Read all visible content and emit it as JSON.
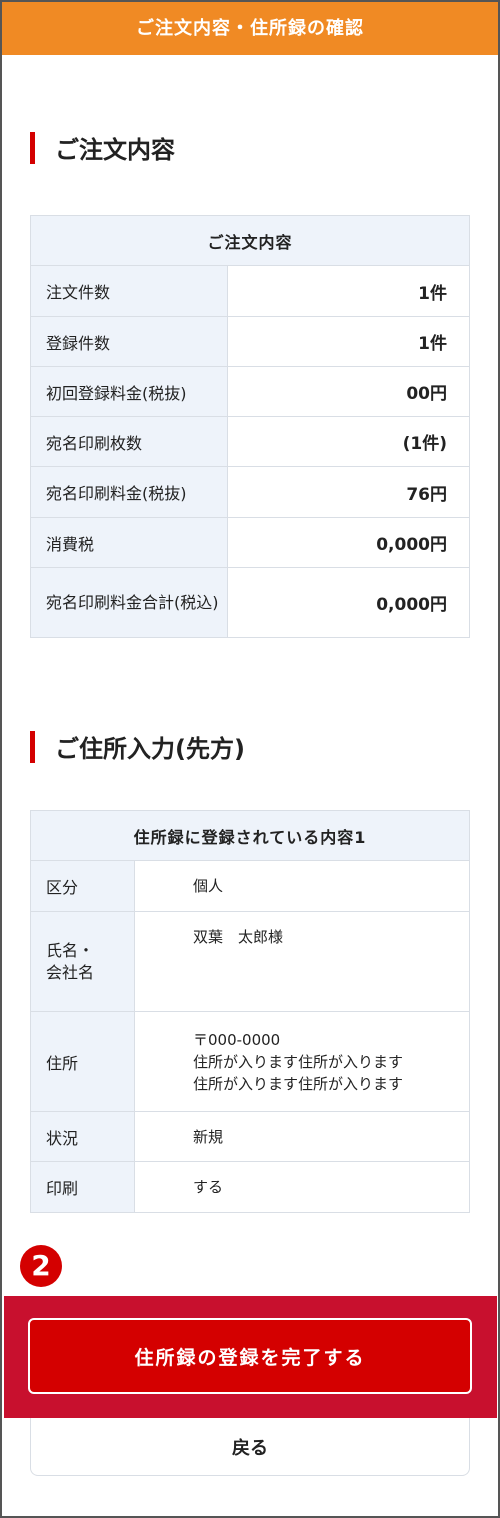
{
  "header": {
    "title": "ご注文内容・住所録の確認"
  },
  "order_section": {
    "title": "ご注文内容",
    "table_header": "ご注文内容",
    "rows": [
      {
        "label": "注文件数",
        "value": "1件"
      },
      {
        "label": "登録件数",
        "value": "1件"
      },
      {
        "label": "初回登録料金(税抜)",
        "value": "00円"
      },
      {
        "label": "宛名印刷枚数",
        "value": "(1件)"
      },
      {
        "label": "宛名印刷料金(税抜)",
        "value": "76円"
      },
      {
        "label": "消費税",
        "value": "0,000円"
      },
      {
        "label": "宛名印刷料金合計(税込)",
        "value": "0,000円"
      }
    ]
  },
  "address_section": {
    "title": "ご住所入力(先方)",
    "table_header": "住所録に登録されている内容1",
    "rows": [
      {
        "label": "区分",
        "value": "個人"
      },
      {
        "label": "氏名・\n会社名",
        "value": "双葉　太郎様"
      },
      {
        "label": "住所",
        "value": "〒000-0000\n住所が入ります住所が入ります\n住所が入ります住所が入ります"
      },
      {
        "label": "状況",
        "value": "新規"
      },
      {
        "label": "印刷",
        "value": "する"
      }
    ]
  },
  "step_badge": "2",
  "buttons": {
    "complete": "住所録の登録を完了する",
    "back": "戻る"
  },
  "colors": {
    "header_bg": "#f08a24",
    "accent_red": "#d40000",
    "table_header_bg": "#eef3fa"
  }
}
